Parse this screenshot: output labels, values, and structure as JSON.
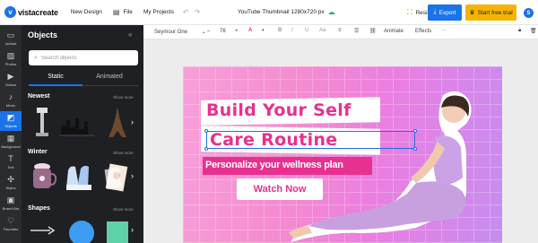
{
  "app": {
    "logo_mark": "v",
    "logo_text": "vistacreate",
    "new_design": "New Design",
    "file": "File",
    "my_projects": "My Projects",
    "doc_title": "YouTube Thumbnail 1280x720 px",
    "resize": "Resize",
    "export": "Export",
    "start_trial": "Start free trial",
    "avatar_initial": "S",
    "brand_color": "#1a73e8",
    "trial_color": "#f6b400"
  },
  "rail": {
    "items": [
      {
        "label": "Upload",
        "icon": "folder-icon"
      },
      {
        "label": "Photos",
        "icon": "image-icon"
      },
      {
        "label": "Videos",
        "icon": "video-icon"
      },
      {
        "label": "Music",
        "icon": "music-icon"
      },
      {
        "label": "Objects",
        "icon": "objects-icon"
      },
      {
        "label": "Background",
        "icon": "background-icon"
      },
      {
        "label": "Text",
        "icon": "text-icon"
      },
      {
        "label": "Styles",
        "icon": "styles-icon"
      },
      {
        "label": "Brand Kits",
        "icon": "brand-kit-icon"
      },
      {
        "label": "Favorites",
        "icon": "heart-icon"
      }
    ]
  },
  "panel": {
    "title": "Objects",
    "search_placeholder": "Search objects",
    "tabs": [
      "Static",
      "Animated"
    ],
    "sections": [
      {
        "title": "Newest",
        "show_more": "Show more"
      },
      {
        "title": "Winter",
        "show_more": "Show more"
      },
      {
        "title": "Shapes",
        "show_more": "Show more"
      }
    ]
  },
  "toolbar": {
    "font": "Seymour One",
    "size": "76",
    "minus": "–",
    "plus": "+",
    "animate": "Animate",
    "effects": "Effects",
    "more": "···"
  },
  "design": {
    "line1": "Build Your Self",
    "line2": "Care Routine",
    "subtitle": "Personalize your wellness plan",
    "button": "Watch Now",
    "accent": "#e8308e"
  }
}
